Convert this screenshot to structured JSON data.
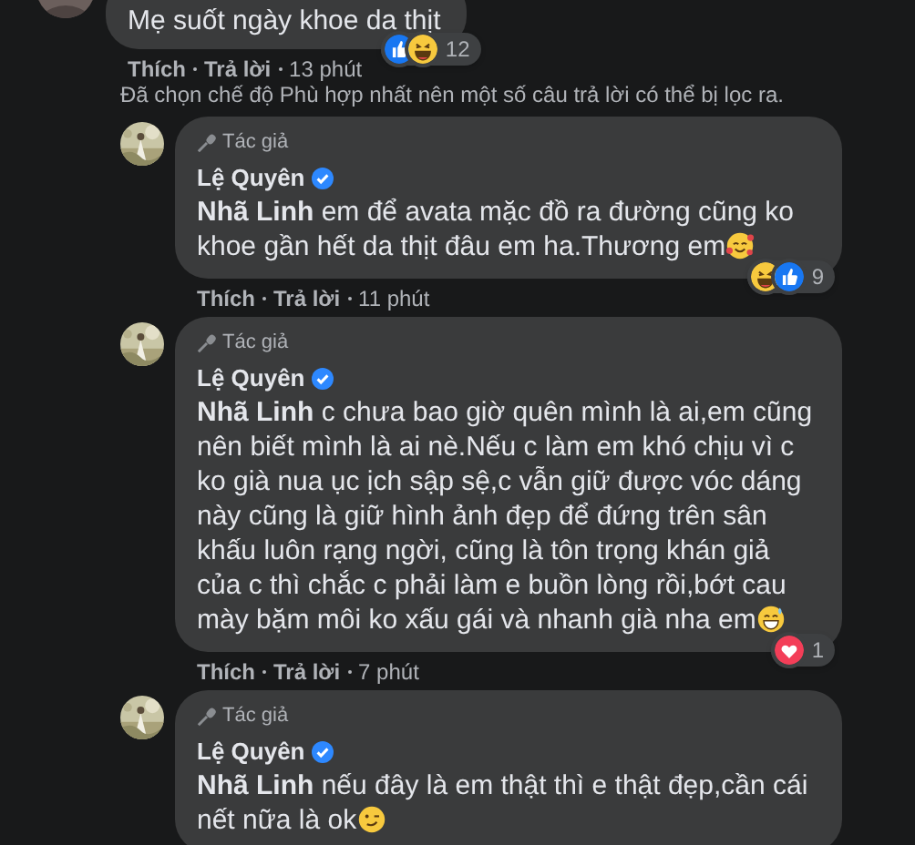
{
  "top_comment": {
    "text": "Mẹ suốt ngày khoe da thịt",
    "reactions": [
      {
        "kind": "like"
      },
      {
        "kind": "haha"
      }
    ],
    "reaction_count": "12",
    "actions": [
      "Thích",
      "Trả lời",
      "13 phút"
    ]
  },
  "filter_notice": "Đã chọn chế độ Phù hợp nhất nên một số câu trả lời có thể bị lọc ra.",
  "replies": [
    {
      "badge": "Tác giả",
      "author": "Lệ Quyên",
      "verified": true,
      "mention": "Nhã Linh",
      "text": "em để avata mặc đồ ra đường cũng ko khoe gần hết da thịt đâu em ha.Thương em",
      "emoji": {
        "kind": "hearts"
      },
      "reactions": [
        {
          "kind": "haha"
        },
        {
          "kind": "like"
        }
      ],
      "reaction_count": "9",
      "actions": [
        "Thích",
        "Trả lời",
        "11 phút"
      ]
    },
    {
      "badge": "Tác giả",
      "author": "Lệ Quyên",
      "verified": true,
      "mention": "Nhã Linh",
      "text": "c chưa bao giờ quên mình là ai,em cũng nên biết mình là ai nè.Nếu c làm em khó chịu vì c ko già nua ục ịch sập sệ,c vẫn giữ được vóc dáng này cũng là giữ hình ảnh đẹp để đứng trên sân khấu luôn rạng ngời, cũng là tôn trọng khán giả của c thì chắc c phải làm e buồn lòng rồi,bớt cau mày bặm môi ko xấu gái và nhanh già nha em",
      "emoji": {
        "kind": "sweat"
      },
      "reactions": [
        {
          "kind": "love"
        }
      ],
      "reaction_count": "1",
      "actions": [
        "Thích",
        "Trả lời",
        "7 phút"
      ]
    },
    {
      "badge": "Tác giả",
      "author": "Lệ Quyên",
      "verified": true,
      "mention": "Nhã Linh",
      "text": "nếu đây là em thật thì e thật đẹp,cần cái nết nữa là ok",
      "emoji": {
        "kind": "smirk"
      }
    }
  ]
}
